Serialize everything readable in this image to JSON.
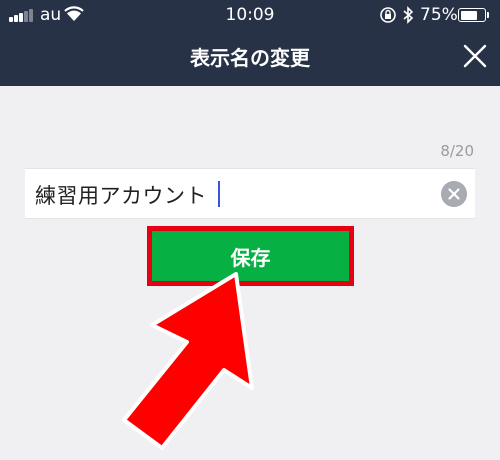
{
  "status_bar": {
    "carrier": "au",
    "time": "10:09",
    "battery_percent": "75%",
    "battery_level": 0.75,
    "signal_bars_filled": 3,
    "signal_bars_total": 5
  },
  "header": {
    "title": "表示名の変更"
  },
  "form": {
    "counter": "8/20",
    "field_value": "練習用アカウント"
  },
  "actions": {
    "save_label": "保存"
  },
  "colors": {
    "header_bg": "#273247",
    "save_green": "#06b043",
    "highlight_red": "#e60012",
    "caret_blue": "#3a56d6"
  },
  "icons": {
    "wifi": "wifi-icon",
    "orientation_lock": "orientation-lock-icon",
    "bluetooth": "bluetooth-icon",
    "close": "close-icon",
    "clear": "clear-text-icon",
    "annotation": "red-arrow-annotation"
  }
}
